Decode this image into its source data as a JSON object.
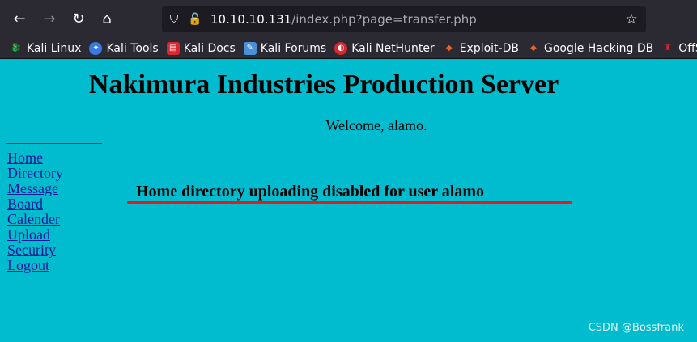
{
  "browser": {
    "url_host": "10.10.10.131",
    "url_path": "/index.php?page=transfer.php",
    "icons": [
      "back-icon",
      "forward-icon",
      "reload-icon",
      "home-icon",
      "shield-icon",
      "lock-icon",
      "star-icon"
    ]
  },
  "bookmarks": [
    {
      "label": "Kali Linux",
      "icon": "kali-dragon-icon",
      "color": "#cfcfcf"
    },
    {
      "label": "Kali Tools",
      "icon": "kali-tools-icon",
      "color": "#3b78e7"
    },
    {
      "label": "Kali Docs",
      "icon": "kali-docs-icon",
      "color": "#d9262f"
    },
    {
      "label": "Kali Forums",
      "icon": "kali-forums-icon",
      "color": "#4a90d9"
    },
    {
      "label": "Kali NetHunter",
      "icon": "nethunter-icon",
      "color": "#d9262f"
    },
    {
      "label": "Exploit-DB",
      "icon": "exploit-db-icon",
      "color": "#e8622c"
    },
    {
      "label": "Google Hacking DB",
      "icon": "ghdb-icon",
      "color": "#e8622c"
    },
    {
      "label": "OffSec",
      "icon": "offsec-icon",
      "color": "#d9262f"
    }
  ],
  "page": {
    "title": "Nakimura Industries Production Server",
    "welcome": "Welcome, alamo.",
    "menu": [
      "Home",
      "Directory",
      "Message",
      "Board",
      "Calender",
      "Upload",
      "Security",
      "Logout"
    ],
    "notice": "Home directory uploading disabled for user alamo",
    "background": "#00bcce",
    "annotation_color": "#e31c1c"
  },
  "watermark": "CSDN @Bossfrank"
}
